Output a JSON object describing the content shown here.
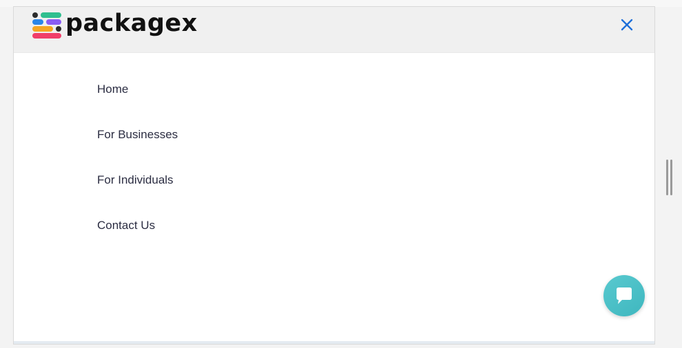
{
  "brand": {
    "name": "packagex",
    "logo_icon": "packagex-logo-mark",
    "logo_colors": [
      "#2c2c2c",
      "#2fbf8f",
      "#2b86e8",
      "#8a5cf5",
      "#f6a623",
      "#f03e6a"
    ]
  },
  "header": {
    "close_icon": "close-icon",
    "close_color": "#1e6fd9"
  },
  "menu": {
    "items": [
      {
        "label": "Home"
      },
      {
        "label": "For Businesses"
      },
      {
        "label": "For Individuals"
      },
      {
        "label": "Contact Us"
      }
    ]
  },
  "chat": {
    "icon": "chat-bubble-icon",
    "color": "#4cc0c8"
  },
  "scrollbar": {
    "icon": "scroll-handle-icon"
  }
}
